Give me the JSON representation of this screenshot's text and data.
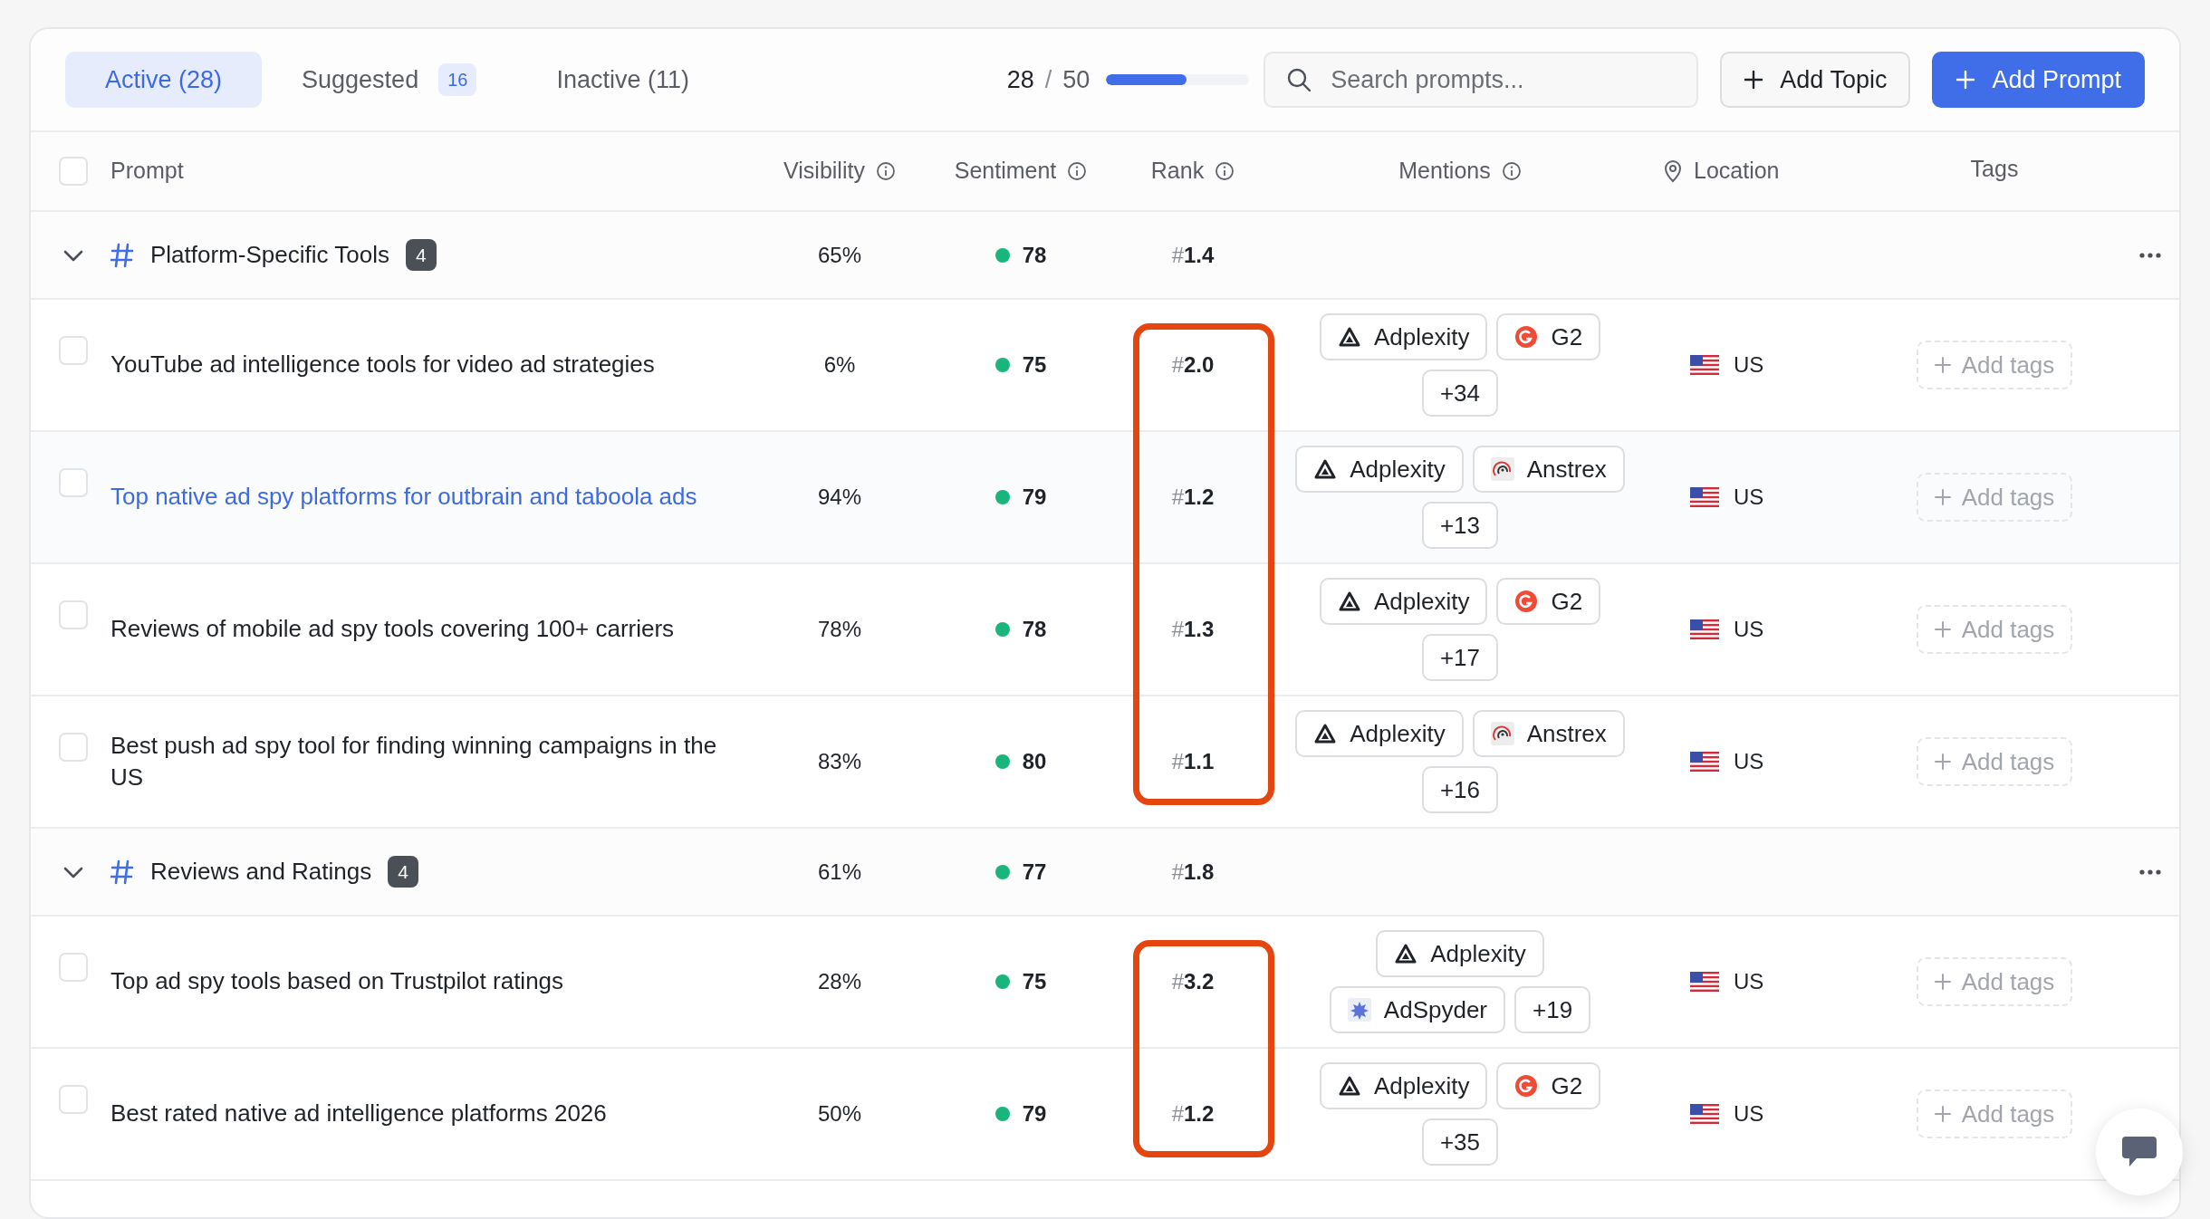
{
  "tabs": [
    {
      "label": "Active (28)",
      "selected": true
    },
    {
      "label": "Suggested",
      "badge": "16",
      "selected": false
    },
    {
      "label": "Inactive (11)",
      "selected": false
    }
  ],
  "usage": {
    "used": "28",
    "separator": "/",
    "limit": "50",
    "level": 0.56
  },
  "search": {
    "placeholder": "Search prompts..."
  },
  "buttons": [
    {
      "label": "Add Topic",
      "kind": "secondary"
    },
    {
      "label": "Add Prompt",
      "kind": "primary"
    }
  ],
  "columns": [
    {
      "label": "Prompt",
      "kind": "plain"
    },
    {
      "label": "Visibility",
      "kind": "info"
    },
    {
      "label": "Sentiment",
      "kind": "info"
    },
    {
      "label": "Rank",
      "kind": "info"
    },
    {
      "label": "Mentions",
      "kind": "info"
    },
    {
      "label": "Location",
      "kind": "location"
    },
    {
      "label": "Tags",
      "kind": "plain"
    }
  ],
  "select_all": {
    "checked": false
  },
  "groups": [
    {
      "name": "Platform-Specific Tools",
      "count": "4",
      "expanded": true,
      "visibility": "65%",
      "sentiment": "78",
      "rank": "#**1.4**",
      "rank_highlight": true,
      "rows": [
        {
          "prompt": "YouTube ad intelligence tools for video ad strategies",
          "checked": false,
          "hovered": false,
          "visibility": "6%",
          "sentiment": "75",
          "rank": "#**2.0**",
          "mentions": [
            {
              "name": "Adplexity",
              "kind": "adplexity"
            },
            {
              "name": "G2",
              "kind": "g2"
            },
            {
              "name": "+34",
              "kind": "more"
            }
          ],
          "location": "US",
          "tags": "Add tags"
        },
        {
          "prompt": "Top native ad spy platforms for outbrain and taboola ads",
          "checked": false,
          "hovered": true,
          "visibility": "94%",
          "sentiment": "79",
          "rank": "#**1.2**",
          "mentions": [
            {
              "name": "Adplexity",
              "kind": "adplexity"
            },
            {
              "name": "Anstrex",
              "kind": "anstrex"
            },
            {
              "name": "+13",
              "kind": "more"
            }
          ],
          "location": "US",
          "tags": "Add tags"
        },
        {
          "prompt": "Reviews of mobile ad spy tools covering 100+ carriers",
          "checked": false,
          "hovered": false,
          "visibility": "78%",
          "sentiment": "78",
          "rank": "#**1.3**",
          "mentions": [
            {
              "name": "Adplexity",
              "kind": "adplexity"
            },
            {
              "name": "G2",
              "kind": "g2"
            },
            {
              "name": "+17",
              "kind": "more"
            }
          ],
          "location": "US",
          "tags": "Add tags"
        },
        {
          "prompt": "Best push ad spy tool for finding winning campaigns in the US",
          "checked": false,
          "hovered": false,
          "visibility": "83%",
          "sentiment": "80",
          "rank": "#**1.1**",
          "mentions": [
            {
              "name": "Adplexity",
              "kind": "adplexity"
            },
            {
              "name": "Anstrex",
              "kind": "anstrex"
            },
            {
              "name": "+16",
              "kind": "more"
            }
          ],
          "location": "US",
          "tags": "Add tags"
        }
      ]
    },
    {
      "name": "Reviews and Ratings",
      "count": "4",
      "expanded": true,
      "visibility": "61%",
      "sentiment": "77",
      "rank": "#**1.8**",
      "rank_highlight": true,
      "rows": [
        {
          "prompt": "Top ad spy tools based on Trustpilot ratings",
          "checked": false,
          "hovered": false,
          "visibility": "28%",
          "sentiment": "75",
          "rank": "#**3.2**",
          "mentions": [
            {
              "name": "Adplexity",
              "kind": "adplexity"
            },
            {
              "name": "AdSpyder",
              "kind": "adspyder"
            },
            {
              "name": "+19",
              "kind": "more"
            }
          ],
          "location": "US",
          "tags": "Add tags"
        },
        {
          "prompt": "Best rated native ad intelligence platforms 2026",
          "checked": false,
          "hovered": false,
          "visibility": "50%",
          "sentiment": "79",
          "rank": "#**1.2**",
          "mentions": [
            {
              "name": "Adplexity",
              "kind": "adplexity"
            },
            {
              "name": "G2",
              "kind": "g2"
            },
            {
              "name": "+35",
              "kind": "more"
            }
          ],
          "location": "US",
          "tags": "Add tags"
        }
      ]
    }
  ]
}
